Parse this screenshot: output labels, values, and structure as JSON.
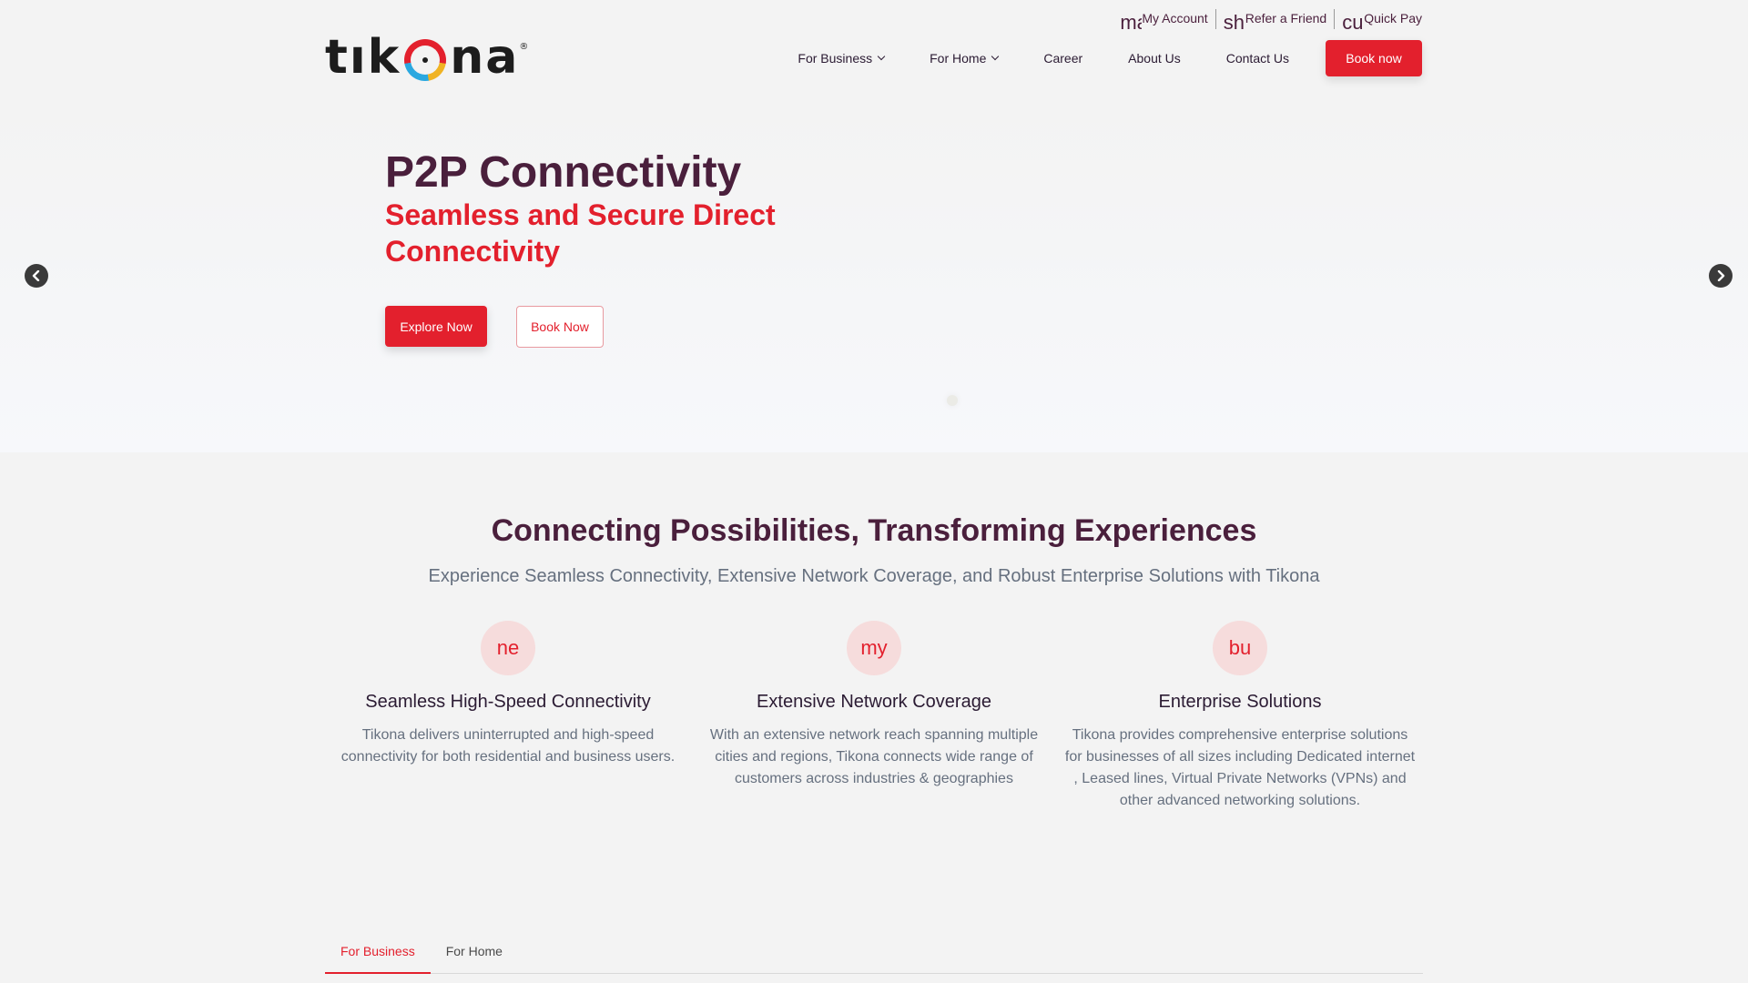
{
  "brand": {
    "logo_text_left": "tık",
    "logo_text_right": "na",
    "logo_mark": "®"
  },
  "utility_nav": [
    {
      "glyph": "ma",
      "label": "My Account"
    },
    {
      "glyph": "sh",
      "label": "Refer a Friend"
    },
    {
      "glyph": "cu",
      "label": "Quick Pay"
    }
  ],
  "main_nav": {
    "items": [
      {
        "label": "For Business",
        "has_dropdown": true
      },
      {
        "label": "For Home",
        "has_dropdown": true
      },
      {
        "label": "Career",
        "has_dropdown": false
      },
      {
        "label": "About Us",
        "has_dropdown": false
      },
      {
        "label": "Contact Us",
        "has_dropdown": false
      }
    ],
    "cta_label": "Book now"
  },
  "hero": {
    "title": "P2P Connectivity",
    "subtitle": "Seamless and Secure Direct Connectivity",
    "explore_label": "Explore Now",
    "book_label": "Book Now"
  },
  "features_section": {
    "title": "Connecting Possibilities, Transforming Experiences",
    "subtitle": "Experience Seamless Connectivity, Extensive Network Coverage, and Robust Enterprise Solutions with Tikona",
    "items": [
      {
        "icon_glyph": "ne",
        "title": "Seamless High-Speed Connectivity",
        "description": "Tikona delivers uninterrupted and high-speed connectivity for both residential and business users."
      },
      {
        "icon_glyph": "my",
        "title": "Extensive Network Coverage",
        "description": "With an extensive network reach spanning multiple cities and regions, Tikona connects wide range of customers across industries & geographies"
      },
      {
        "icon_glyph": "bu",
        "title": "Enterprise Solutions",
        "description": "Tikona provides comprehensive enterprise solutions for businesses of all sizes including Dedicated internet , Leased lines, Virtual Private Networks (VPNs) and other advanced networking solutions."
      }
    ]
  },
  "tabs": [
    {
      "label": "For Business",
      "active": true
    },
    {
      "label": "For Home",
      "active": false
    }
  ],
  "colors": {
    "brand_red": "#e3202d",
    "brand_plum": "#4a1f3c",
    "muted_text": "#66707f",
    "page_bg": "#f3f3f3"
  }
}
